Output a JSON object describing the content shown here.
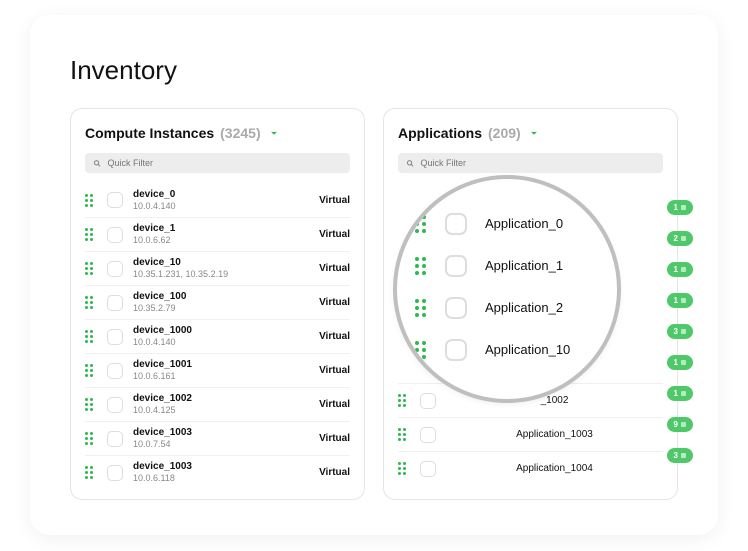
{
  "page_title": "Inventory",
  "panels": {
    "compute": {
      "title": "Compute Instances",
      "count": "(3245)",
      "filter_placeholder": "Quick Filter",
      "type_label": "Virtual",
      "rows": [
        {
          "name": "device_0",
          "sub": "10.0.4.140"
        },
        {
          "name": "device_1",
          "sub": "10.0.6.62"
        },
        {
          "name": "device_10",
          "sub": "10.35.1.231, 10.35.2.19"
        },
        {
          "name": "device_100",
          "sub": "10.35.2.79"
        },
        {
          "name": "device_1000",
          "sub": "10.0.4.140"
        },
        {
          "name": "device_1001",
          "sub": "10.0.6.161"
        },
        {
          "name": "device_1002",
          "sub": "10.0.4.125"
        },
        {
          "name": "device_1003",
          "sub": "10.0.7.54"
        },
        {
          "name": "device_1003",
          "sub": "10.0.6.118"
        }
      ]
    },
    "apps": {
      "title": "Applications",
      "count": "(209)",
      "filter_placeholder": "Quick Filter",
      "zoom_rows": [
        {
          "name": "Application_0"
        },
        {
          "name": "Application_1"
        },
        {
          "name": "Application_2"
        },
        {
          "name": "Application_10"
        }
      ],
      "rows_behind": [
        {
          "name": "_1002"
        },
        {
          "name": "Application_1003"
        },
        {
          "name": "Application_1004"
        }
      ],
      "badges": [
        "1",
        "2",
        "1",
        "1",
        "3",
        "1",
        "1",
        "9",
        "3"
      ]
    }
  }
}
